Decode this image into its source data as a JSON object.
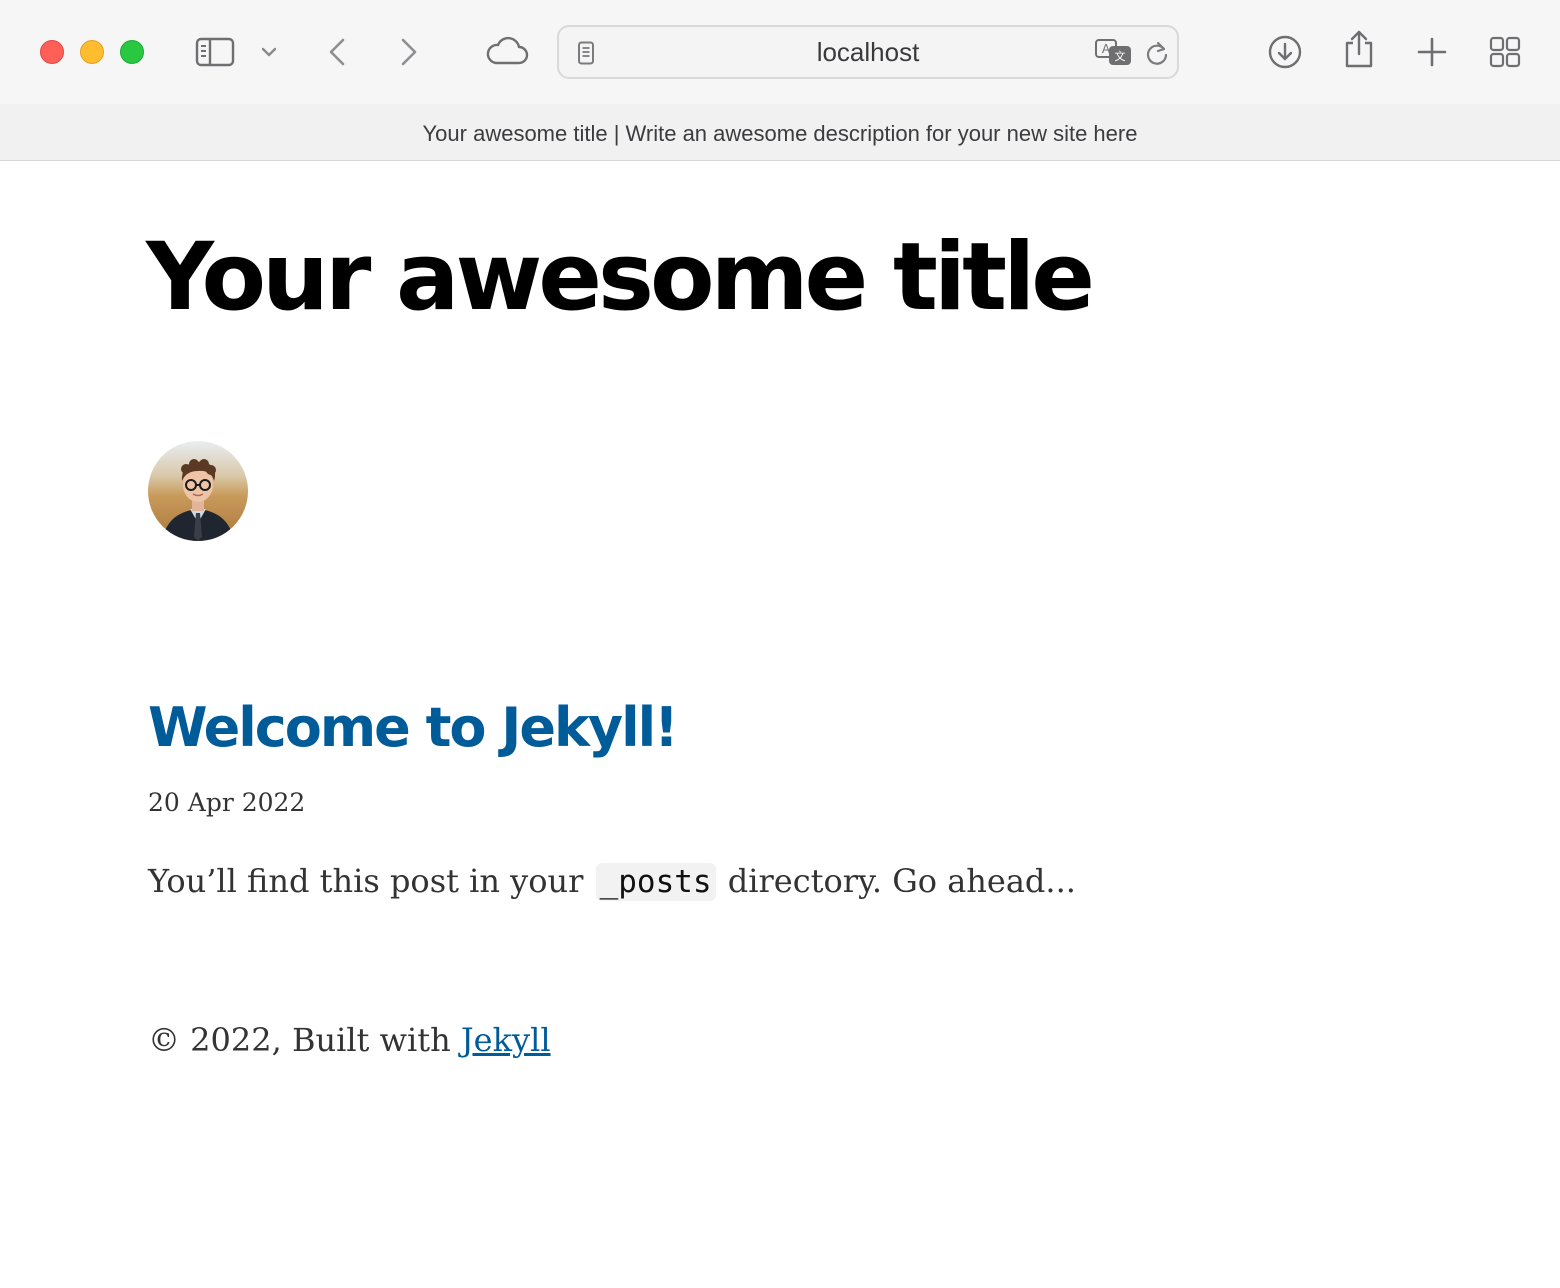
{
  "browser": {
    "address": "localhost",
    "tab_title": "Your awesome title | Write an awesome description for your new site here"
  },
  "site": {
    "title": "Your awesome title",
    "avatar_alt": "author-avatar"
  },
  "posts": [
    {
      "title": "Welcome to Jekyll!",
      "date": "20 Apr 2022",
      "excerpt_before": "You’ll find this post in your",
      "excerpt_code": "_posts",
      "excerpt_after": "directory. Go ahead..."
    }
  ],
  "footer": {
    "prefix": "© 2022, Built with",
    "link_label": "Jekyll"
  },
  "colors": {
    "link": "#005b99",
    "title": "#000000",
    "text": "#333333"
  }
}
